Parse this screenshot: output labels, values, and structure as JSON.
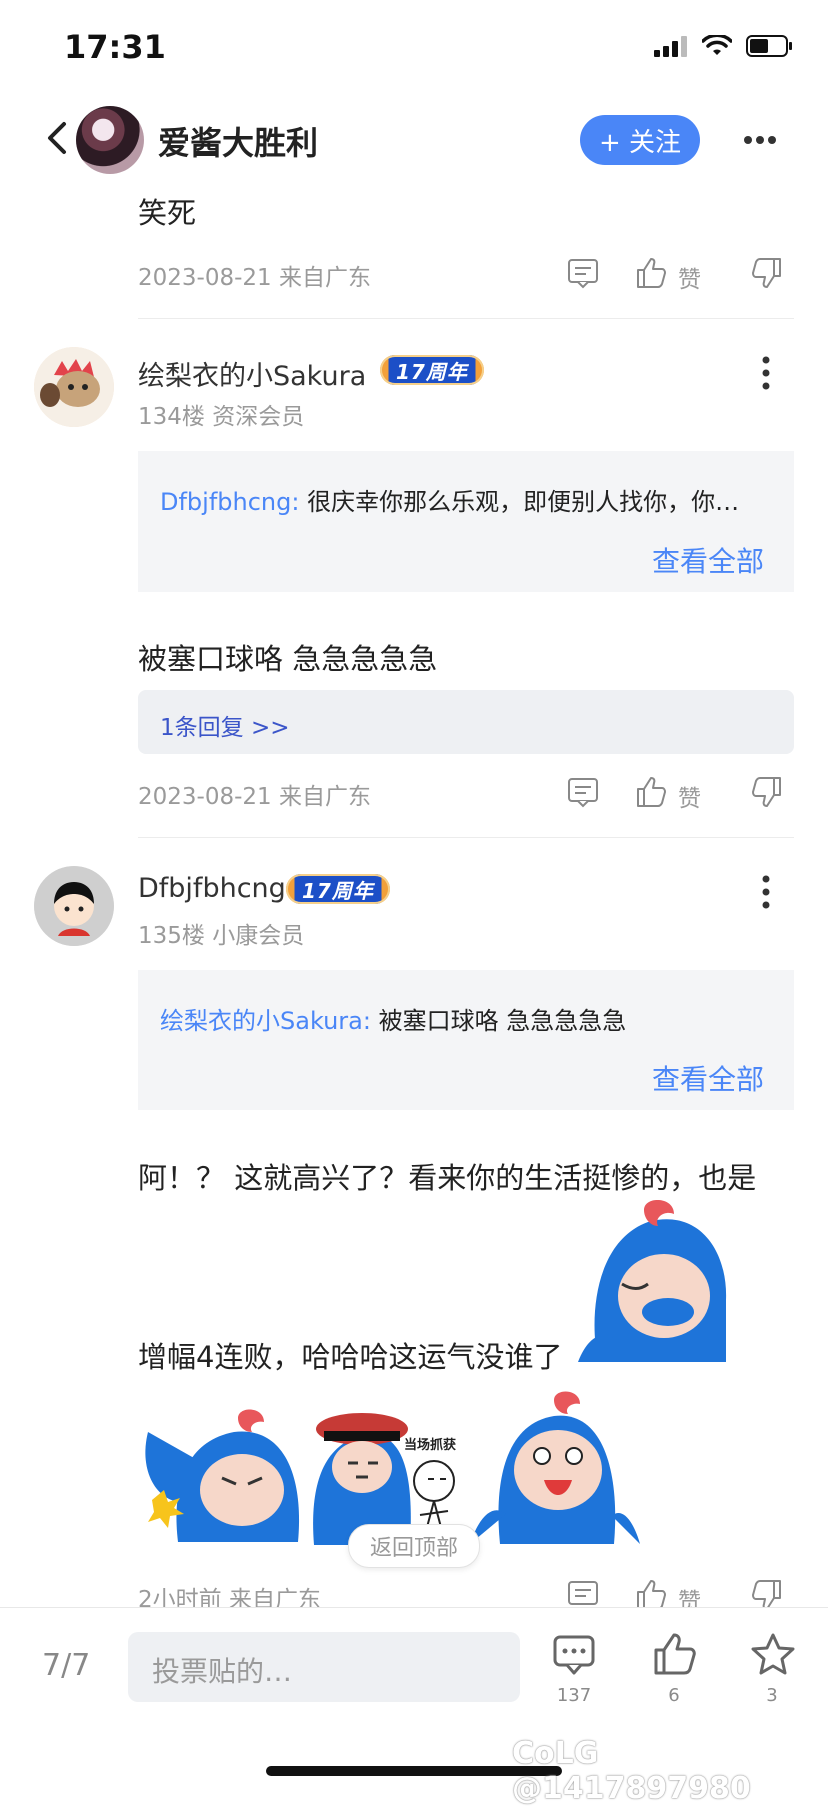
{
  "status_bar": {
    "time": "17:31"
  },
  "header": {
    "title": "爱酱大胜利",
    "follow_label": "+ 关注"
  },
  "post_top": {
    "text": "笑死",
    "meta": "2023-08-21 来自广东",
    "like_label": "赞"
  },
  "comments": [
    {
      "name": "绘梨衣的小Sakura",
      "badge": "17周年",
      "floor": "134楼 资深会员",
      "quote_author": "Dfbjfbhcng:",
      "quote_text": " 很庆幸你那么乐观，即便别人找你，你…",
      "view_all": "查看全部",
      "text": "被塞口球咯 急急急急急",
      "reply_summary": "1条回复 >>",
      "meta": "2023-08-21 来自广东",
      "like_label": "赞"
    },
    {
      "name": "Dfbjfbhcng",
      "badge": "17周年",
      "floor": "135楼 小康会员",
      "quote_author": "绘梨衣的小Sakura:",
      "quote_text": " 被塞口球咯 急急急急急",
      "view_all": "查看全部",
      "text_line1": "阿！？ 这就高兴了？看来你的生活挺惨的，也是",
      "text_line2": "增幅4连败，哈哈哈这运气没谁了",
      "sticker_caption": "当场抓获",
      "meta": "2小时前 来自广东",
      "like_label": "赞"
    }
  ],
  "back_to_top": "返回顶部",
  "bottom_bar": {
    "page": "7/7",
    "placeholder": "投票贴的…",
    "comment_count": "137",
    "like_count": "6",
    "star_count": "3"
  },
  "watermark": "CoLG @1417897980",
  "colors": {
    "accent": "#4a86f7",
    "reply_link": "#3b55c9",
    "meta": "#9a9a9a"
  }
}
